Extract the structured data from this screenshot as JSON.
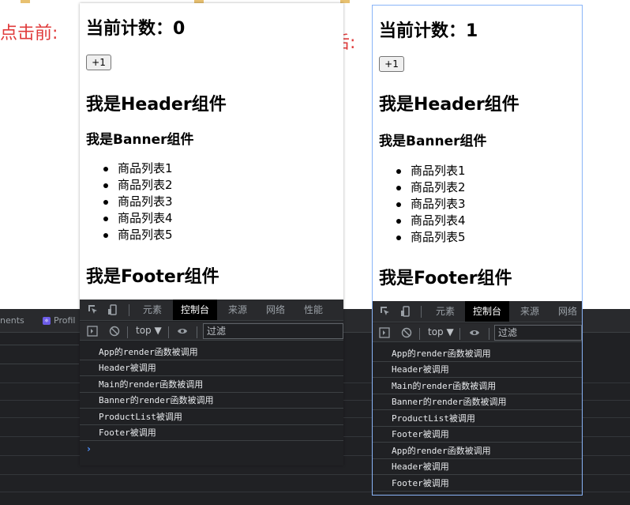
{
  "annotations": {
    "before": "点击前:",
    "after": "点击后:"
  },
  "background_tabs": [
    "nents",
    "Profil"
  ],
  "before": {
    "count_label": "当前计数：0",
    "button": "+1",
    "header": "我是Header组件",
    "banner": "我是Banner组件",
    "products": [
      "商品列表1",
      "商品列表2",
      "商品列表3",
      "商品列表4",
      "商品列表5"
    ],
    "footer": "我是Footer组件",
    "devtools": {
      "tabs": [
        "元素",
        "控制台",
        "来源",
        "网络",
        "性能"
      ],
      "active_tab": "控制台",
      "context": "top ▼",
      "filter_placeholder": "过滤",
      "logs": [
        "App的render函数被调用",
        "Header被调用",
        "Main的render函数被调用",
        "Banner的render函数被调用",
        "ProductList被调用",
        "Footer被调用"
      ],
      "prompt": "›"
    }
  },
  "after": {
    "count_label": "当前计数：1",
    "button": "+1",
    "header": "我是Header组件",
    "banner": "我是Banner组件",
    "products": [
      "商品列表1",
      "商品列表2",
      "商品列表3",
      "商品列表4",
      "商品列表5"
    ],
    "footer": "我是Footer组件",
    "devtools": {
      "tabs": [
        "元素",
        "控制台",
        "来源",
        "网络"
      ],
      "active_tab": "控制台",
      "context": "top ▼",
      "filter_placeholder": "过滤",
      "logs": [
        "App的render函数被调用",
        "Header被调用",
        "Main的render函数被调用",
        "Banner的render函数被调用",
        "ProductList被调用",
        "Footer被调用",
        "App的render函数被调用",
        "Header被调用",
        "Footer被调用"
      ]
    }
  },
  "colors": {
    "annotation": "#e03b3b",
    "devtools_bg": "#202124",
    "active_tab_bg": "#000000",
    "prompt": "#4c8df6"
  }
}
